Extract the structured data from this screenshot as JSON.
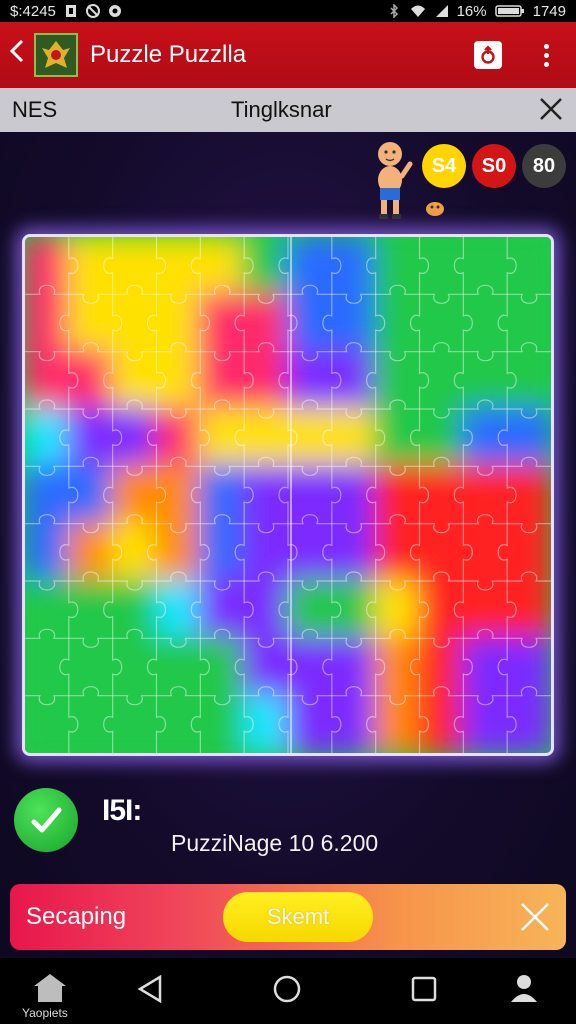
{
  "status": {
    "time_left": "$:4245",
    "battery": "16%",
    "time_right": "1749"
  },
  "appbar": {
    "title": "Puzzle Puzzlla"
  },
  "subbar": {
    "left": "NES",
    "center": "Tinglksnar"
  },
  "hud": {
    "coins": [
      {
        "label": "S4",
        "color": "#ffd400"
      },
      {
        "label": "S0",
        "color": "#d31515"
      },
      {
        "label": "80",
        "color": "#3c3c3c"
      }
    ]
  },
  "board": {
    "rows": 9,
    "cols": 12,
    "region_colors": [
      "#ffe100",
      "#ff2a6a",
      "#22c84a",
      "#2a6bff",
      "#7b2cff",
      "#ff2222",
      "#19e6ff",
      "#ff8a00"
    ]
  },
  "score": {
    "big": "I5I:",
    "sub": "PuzziNage 10 6.200"
  },
  "bottom_bar": {
    "label": "Secaping",
    "button": "Skemt"
  },
  "navbar": {
    "home_label": "Yaopiets"
  }
}
